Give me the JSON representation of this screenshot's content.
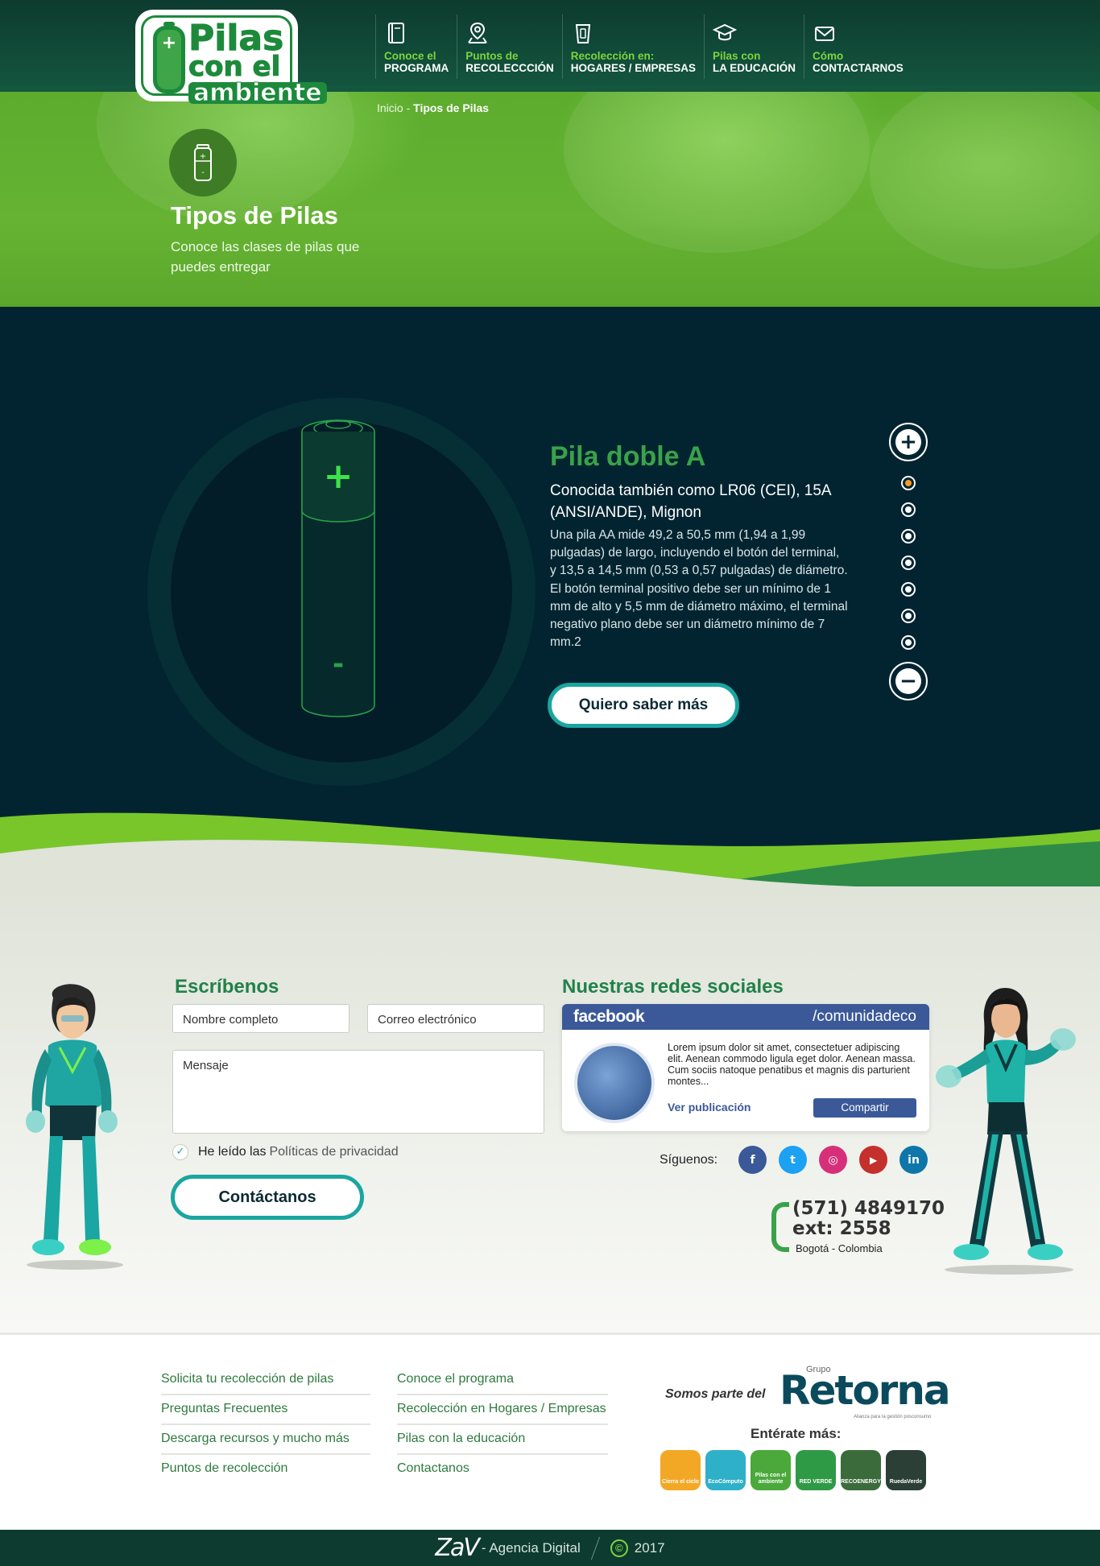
{
  "header": {
    "logo": {
      "line1": "Pilas",
      "line2": "con el",
      "line3": "ambiente"
    },
    "nav": [
      {
        "top": "Conoce el",
        "bottom": "PROGRAMA",
        "icon": "book-icon"
      },
      {
        "top": "Puntos de",
        "bottom": "RECOLECCCIÓN",
        "icon": "map-pin-icon"
      },
      {
        "top": "Recolección en:",
        "bottom": "HOGARES / EMPRESAS",
        "icon": "battery-bin-icon"
      },
      {
        "top": "Pilas con",
        "bottom": "LA EDUCACIÓN",
        "icon": "graduation-cap-icon"
      },
      {
        "top": "Cómo",
        "bottom": "CONTACTARNOS",
        "icon": "envelope-icon"
      }
    ]
  },
  "hero": {
    "breadcrumb_home": "Inicio",
    "breadcrumb_sep": " - ",
    "breadcrumb_current": "Tipos de Pilas",
    "title": "Tipos de Pilas",
    "subtitle": "Conoce las clases de pilas que puedes entregar",
    "icon": "battery-icon"
  },
  "product": {
    "title": "Pila doble A",
    "subtitle": "Conocida también como LR06 (CEI), 15A (ANSI/ANDE), Mignon",
    "description": "Una pila AA mide 49,2 a 50,5 mm (1,94 a 1,99 pulgadas) de largo, incluyendo el botón del terminal, y 13,5 a 14,5 mm (0,53 a 0,57 pulgadas) de diámetro. El botón terminal positivo debe ser un mínimo de 1 mm de alto y 5,5 mm de diámetro máximo, el terminal negativo plano debe ser un diámetro mínimo de 7 mm.2",
    "button": "Quiero saber más",
    "battery_plus": "+",
    "battery_minus": "-",
    "slider_up": "+",
    "slider_down": "−",
    "slides_count": 7,
    "active_slide": 1
  },
  "contact": {
    "form_title": "Escríbenos",
    "name_placeholder": "Nombre completo",
    "email_placeholder": "Correo electrónico",
    "message_placeholder": "Mensaje",
    "privacy_prefix": "He leído las",
    "privacy_link": "Políticas de privacidad",
    "privacy_checked": true,
    "submit": "Contáctanos",
    "social_title": "Nuestras redes sociales",
    "facebook": {
      "brand": "facebook",
      "handle": "/comunidadeco",
      "post_text": "Lorem ipsum dolor sit amet, consectetuer adipiscing elit. Aenean commodo ligula eget dolor. Aenean massa. Cum sociis natoque penatibus et magnis dis parturient montes...",
      "view_link": "Ver publicación",
      "share": "Compartir"
    },
    "follow_label": "Síguenos:",
    "social": [
      {
        "name": "facebook",
        "glyph": "f",
        "color": "#3b5998"
      },
      {
        "name": "twitter",
        "glyph": "t",
        "color": "#1da1f2"
      },
      {
        "name": "instagram",
        "glyph": "◎",
        "color": "#d6307b"
      },
      {
        "name": "youtube",
        "glyph": "▶",
        "color": "#c4302b"
      },
      {
        "name": "linkedin",
        "glyph": "in",
        "color": "#0e76a8"
      }
    ],
    "phone": "(571) 4849170",
    "ext": "ext: 2558",
    "city": "Bogotá - Colombia"
  },
  "footer": {
    "col1": [
      "Solicita tu recolección de pilas",
      "Preguntas Frecuentes",
      "Descarga recursos y mucho más",
      "Puntos de recolección"
    ],
    "col2": [
      "Conoce el programa",
      "Recolección en Hogares / Empresas",
      "Pilas con la educación",
      "Contactanos"
    ],
    "somos": "Somos parte del",
    "grupo": "Grupo",
    "retorna": "Retorna",
    "retorna_tag": "Alianza para la gestión posconsumo",
    "enterate": "Entérate más:",
    "badges": [
      {
        "label": "Cierra el ciclo",
        "color": "#f3a825"
      },
      {
        "label": "EcoCómputo",
        "color": "#2eb0c8"
      },
      {
        "label": "Pilas con el ambiente",
        "color": "#4aa93a"
      },
      {
        "label": "RED VERDE",
        "color": "#2f9a45"
      },
      {
        "label": "RECOENERGY",
        "color": "#3b6b3a"
      },
      {
        "label": "RuedaVerde",
        "color": "#2b3f36"
      }
    ]
  },
  "bottom": {
    "zav": "ZaV",
    "agency": "- Agencia Digital",
    "copyright": "©",
    "year": "2017"
  }
}
